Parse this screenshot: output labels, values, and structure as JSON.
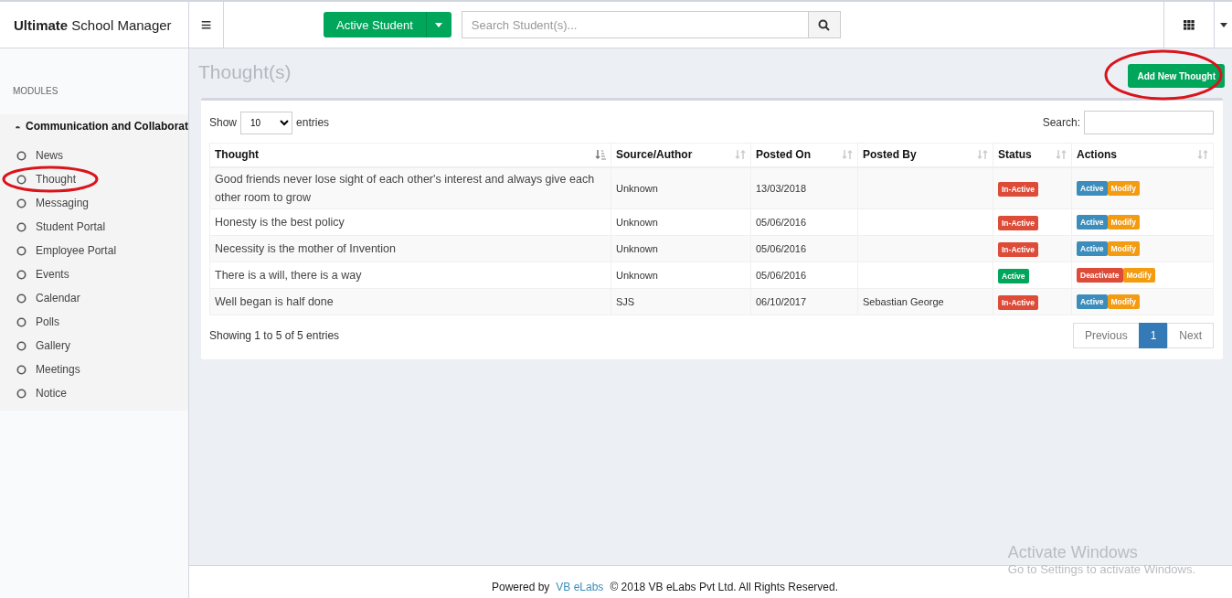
{
  "header": {
    "brand": "**Ultimate** School Manager",
    "menu_icon": "≡",
    "student_filter": "Active Student",
    "search": {
      "placeholder": "Search Student(s)..."
    }
  },
  "sidebar": {
    "section": "MODULES",
    "group": "Communication and Collaborat",
    "items": [
      {
        "label": "News",
        "circled": false
      },
      {
        "label": "Thought",
        "circled": true
      },
      {
        "label": "Messaging",
        "circled": false
      },
      {
        "label": "Student Portal",
        "circled": false
      },
      {
        "label": "Employee Portal",
        "circled": false
      },
      {
        "label": "Events",
        "circled": false
      },
      {
        "label": "Calendar",
        "circled": false
      },
      {
        "label": "Polls",
        "circled": false
      },
      {
        "label": "Gallery",
        "circled": false
      },
      {
        "label": "Meetings",
        "circled": false
      },
      {
        "label": "Notice",
        "circled": false
      }
    ]
  },
  "page": {
    "title": "Thought(s)",
    "add_button": {
      "label": "Add New Thought",
      "circled": true
    }
  },
  "table": {
    "show_label": "Show",
    "page_size": "10",
    "entries_label": "entries",
    "search_label": "Search:",
    "columns": [
      {
        "label": "Thought",
        "sorted": true
      },
      {
        "label": "Source/Author",
        "sorted": false
      },
      {
        "label": "Posted On",
        "sorted": false
      },
      {
        "label": "Posted By",
        "sorted": false
      },
      {
        "label": "Status",
        "sorted": false
      },
      {
        "label": "Actions",
        "sorted": false
      }
    ],
    "rows": [
      {
        "thought": "Good friends never lose sight of each other's interest and always give each other room to grow",
        "source": "Unknown",
        "posted_on": "13/03/2018",
        "posted_by": "",
        "status": {
          "label": "In-Active",
          "active": false
        },
        "actions": [
          {
            "label": "Active",
            "kind": "activate"
          },
          {
            "label": "Modify",
            "kind": "modify"
          }
        ]
      },
      {
        "thought": "Honesty is the best policy",
        "source": "Unknown",
        "posted_on": "05/06/2016",
        "posted_by": "",
        "status": {
          "label": "In-Active",
          "active": false
        },
        "actions": [
          {
            "label": "Active",
            "kind": "activate"
          },
          {
            "label": "Modify",
            "kind": "modify"
          }
        ]
      },
      {
        "thought": "Necessity is the mother of Invention",
        "source": "Unknown",
        "posted_on": "05/06/2016",
        "posted_by": "",
        "status": {
          "label": "In-Active",
          "active": false
        },
        "actions": [
          {
            "label": "Active",
            "kind": "activate"
          },
          {
            "label": "Modify",
            "kind": "modify"
          }
        ]
      },
      {
        "thought": "There is a will, there is a way",
        "source": "Unknown",
        "posted_on": "05/06/2016",
        "posted_by": "",
        "status": {
          "label": "Active",
          "active": true
        },
        "actions": [
          {
            "label": "Deactivate",
            "kind": "deactivate"
          },
          {
            "label": "Modify",
            "kind": "modify"
          }
        ]
      },
      {
        "thought": "Well began is half done",
        "source": "SJS",
        "posted_on": "06/10/2017",
        "posted_by": "Sebastian George",
        "status": {
          "label": "In-Active",
          "active": false
        },
        "actions": [
          {
            "label": "Active",
            "kind": "activate"
          },
          {
            "label": "Modify",
            "kind": "modify"
          }
        ]
      }
    ],
    "info": "Showing 1 to 5 of 5 entries",
    "pagination": [
      {
        "label": "Previous",
        "selected": false
      },
      {
        "label": "1",
        "selected": true
      },
      {
        "label": "Next",
        "selected": false
      }
    ]
  },
  "os_notice": {
    "title": "Activate Windows",
    "text": "Go to Settings to activate Windows."
  },
  "footer": {
    "prefix": "Powered by",
    "link": "VB eLabs",
    "suffix": "© 2018 VB eLabs Pvt Ltd. All Rights Reserved."
  }
}
